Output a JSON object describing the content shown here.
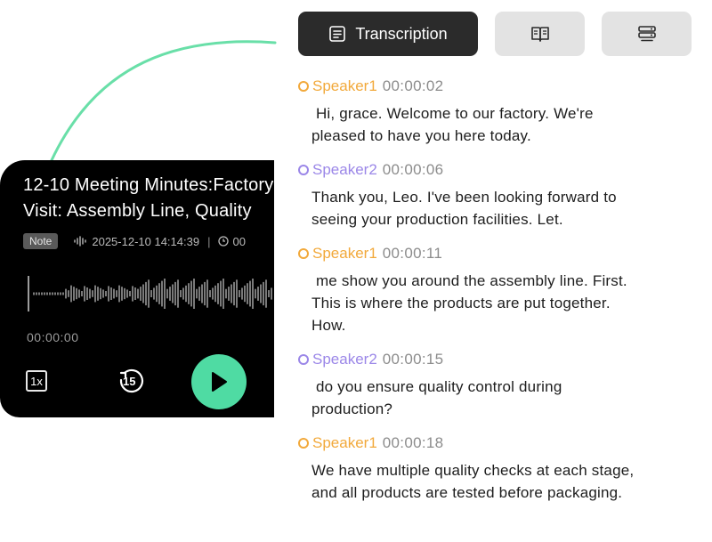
{
  "player": {
    "title": "12-10 Meeting Minutes:Factory\nVisit: Assembly Line, Quality",
    "badge": "Note",
    "datetime": "2025-12-10 14:14:39",
    "separator": "|",
    "duration_truncated": "00",
    "elapsed": "00:00:00",
    "speed_label": "1x",
    "rewind_label": "15"
  },
  "tabs": {
    "active_label": "Transcription",
    "icons": [
      "document-list-icon",
      "book-icon",
      "server-icon"
    ]
  },
  "colors": {
    "speaker1": "#f2a93b",
    "speaker2": "#9b87e8",
    "play_button": "#4fdba3",
    "arc": "#69dfa8"
  },
  "transcript": [
    {
      "speaker": "Speaker1",
      "time": "00:00:02",
      "text": " Hi, grace. Welcome to our factory. We're\npleased to have you here today."
    },
    {
      "speaker": "Speaker2",
      "time": "00:00:06",
      "text": "Thank you, Leo. I've been looking forward to\nseeing your production facilities. Let."
    },
    {
      "speaker": "Speaker1",
      "time": "00:00:11",
      "text": " me show you around the assembly line. First.\nThis is where the products are put together.\nHow."
    },
    {
      "speaker": "Speaker2",
      "time": "00:00:15",
      "text": " do you ensure quality control during\nproduction?"
    },
    {
      "speaker": "Speaker1",
      "time": "00:00:18",
      "text": "We have multiple quality checks at each stage,\nand all products are tested before packaging."
    }
  ]
}
